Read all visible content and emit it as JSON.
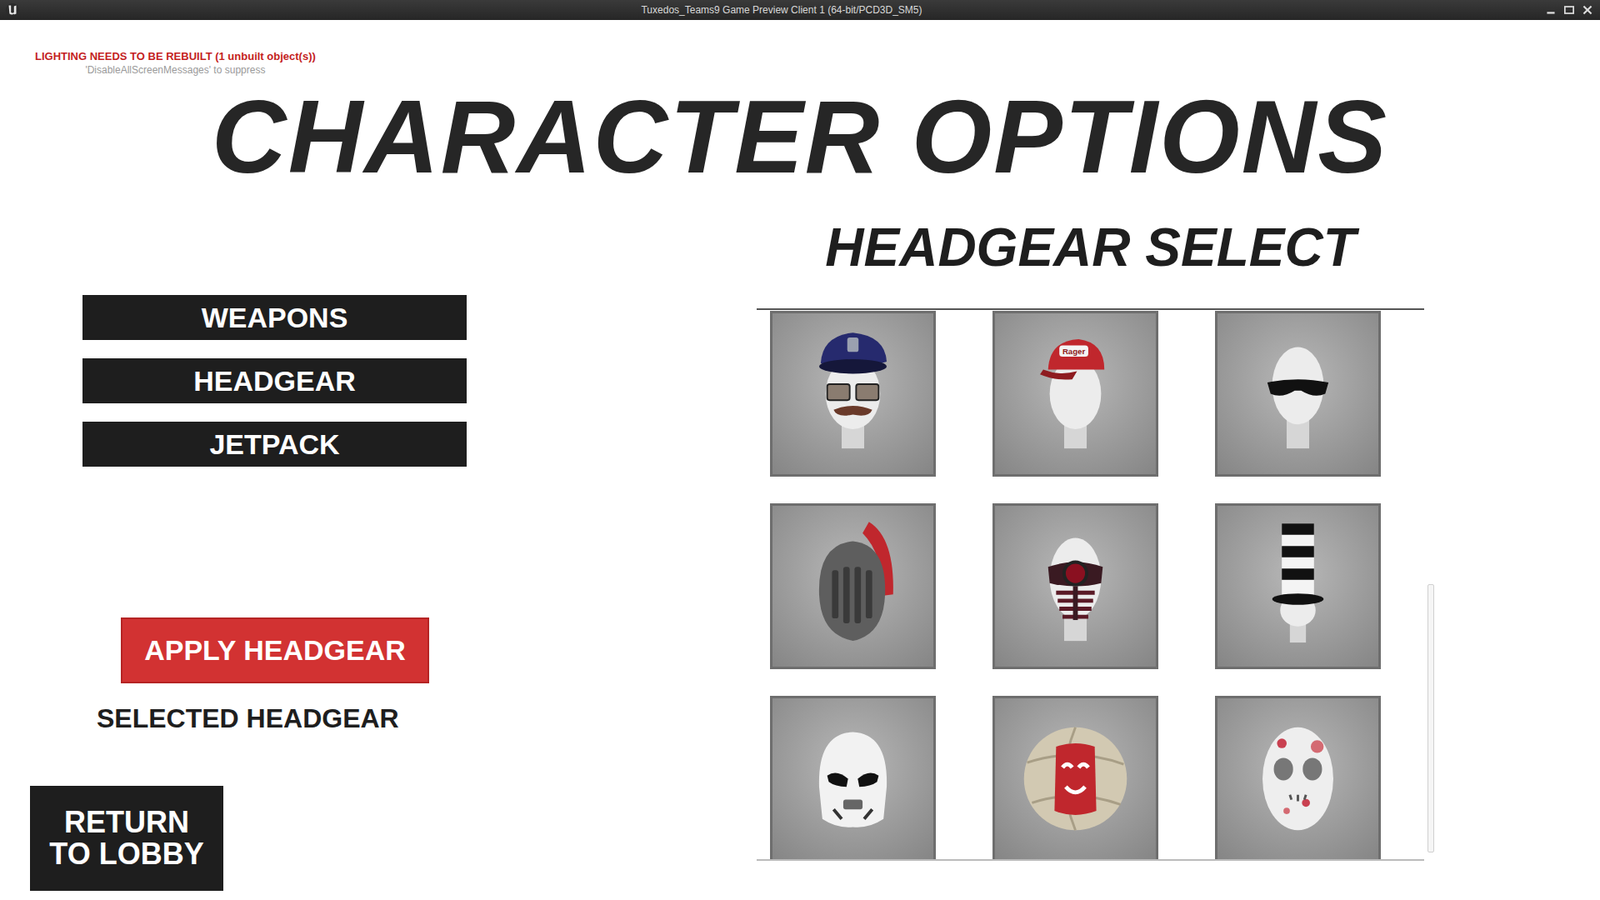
{
  "window": {
    "title": "Tuxedos_Teams9 Game Preview Client 1 (64-bit/PCD3D_SM5)"
  },
  "debug_messages": [
    {
      "text": "LIGHTING NEEDS TO BE REBUILT (1 unbuilt object(s))",
      "kind": "error"
    },
    {
      "text": "'DisableAllScreenMessages' to suppress",
      "kind": "hint"
    }
  ],
  "title": "CHARACTER OPTIONS",
  "menu": [
    {
      "label": "WEAPONS"
    },
    {
      "label": "HEADGEAR"
    },
    {
      "label": "JETPACK"
    }
  ],
  "apply_button": "APPLY HEADGEAR",
  "selected_label": "SELECTED HEADGEAR",
  "return_button": "RETURN TO LOBBY",
  "panel": {
    "heading": "HEADGEAR SELECT",
    "items": [
      {
        "kind": "police-cap",
        "selected": false
      },
      {
        "kind": "baseball-cap",
        "label": "Rager",
        "selected": false
      },
      {
        "kind": "sunglasses",
        "selected": false
      },
      {
        "kind": "knight-helmet",
        "selected": false
      },
      {
        "kind": "scope-mask",
        "selected": false
      },
      {
        "kind": "striped-top-hat",
        "selected": false
      },
      {
        "kind": "stormtrooper-helmet",
        "selected": false
      },
      {
        "kind": "volleyball",
        "selected": false
      },
      {
        "kind": "hockey-mask",
        "selected": false
      }
    ]
  }
}
